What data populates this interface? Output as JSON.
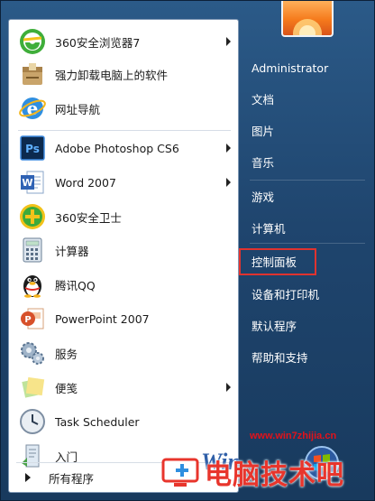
{
  "start_menu": {
    "programs": [
      {
        "label": "360安全浏览器7",
        "icon": "360-browser-icon",
        "has_submenu": true
      },
      {
        "label": "强力卸载电脑上的软件",
        "icon": "uninstall-box-icon",
        "has_submenu": false
      },
      {
        "label": "网址导航",
        "icon": "ie-globe-icon",
        "has_submenu": false
      },
      {
        "label": "Adobe Photoshop CS6",
        "icon": "photoshop-icon",
        "has_submenu": true
      },
      {
        "label": "Word 2007",
        "icon": "word-icon",
        "has_submenu": true
      },
      {
        "label": "360安全卫士",
        "icon": "360-guard-icon",
        "has_submenu": false
      },
      {
        "label": "计算器",
        "icon": "calculator-icon",
        "has_submenu": false
      },
      {
        "label": "腾讯QQ",
        "icon": "qq-penguin-icon",
        "has_submenu": false
      },
      {
        "label": "PowerPoint 2007",
        "icon": "powerpoint-icon",
        "has_submenu": false
      },
      {
        "label": "服务",
        "icon": "gears-icon",
        "has_submenu": false
      },
      {
        "label": "便笺",
        "icon": "sticky-notes-icon",
        "has_submenu": true
      },
      {
        "label": "Task Scheduler",
        "icon": "clock-icon",
        "has_submenu": false
      },
      {
        "label": "入门",
        "icon": "getting-started-icon",
        "has_submenu": false
      }
    ],
    "all_programs_label": "所有程序",
    "right_links": [
      {
        "label": "Administrator"
      },
      {
        "label": "文档"
      },
      {
        "label": "图片"
      },
      {
        "label": "音乐"
      },
      {
        "label": "游戏"
      },
      {
        "label": "计算机"
      },
      {
        "label": "控制面板",
        "highlighted": true
      },
      {
        "label": "设备和打印机"
      },
      {
        "label": "默认程序"
      },
      {
        "label": "帮助和支持"
      }
    ],
    "colors": {
      "highlight_box": "#e0332f",
      "pane_bg": "#ffffff",
      "menu_bg": "#1f456e"
    }
  },
  "watermark": {
    "url": "www.win7zhijia.cn",
    "site_name": "电脑技术吧",
    "win_text": "Win"
  }
}
